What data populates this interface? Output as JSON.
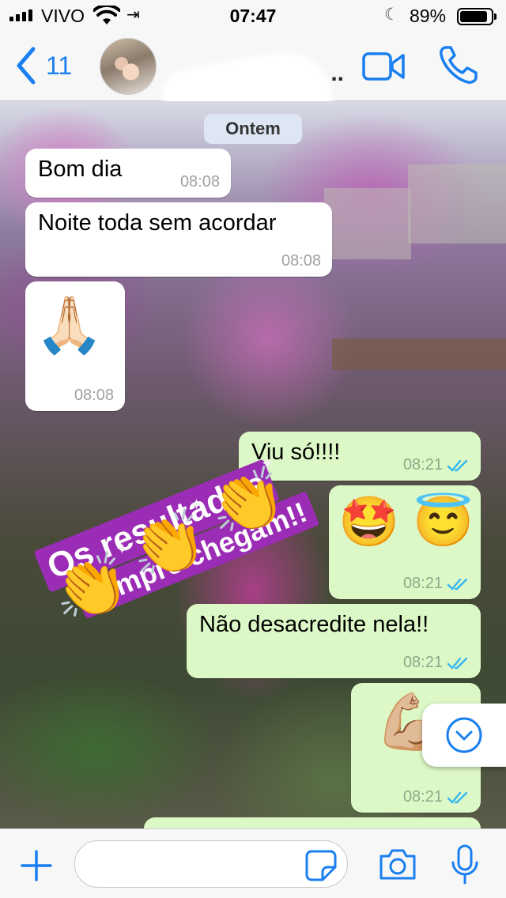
{
  "status_bar": {
    "carrier": "VIVO",
    "time": "07:47",
    "battery_percent": "89%",
    "battery_level": 0.89,
    "icons": [
      "signal-icon",
      "wifi-icon",
      "login-arrow-icon",
      "do-not-disturb-moon-icon",
      "battery-icon"
    ]
  },
  "nav": {
    "back_count": "11",
    "contact_name": "..",
    "icons": [
      "back-chevron-icon",
      "video-call-icon",
      "phone-call-icon"
    ]
  },
  "chat": {
    "date_separator": "Ontem",
    "messages": [
      {
        "direction": "in",
        "text": "Bom dia",
        "time": "08:08"
      },
      {
        "direction": "in",
        "text": "Noite toda sem acordar",
        "time": "08:08"
      },
      {
        "direction": "in",
        "emoji": "🙏🏻",
        "time": "08:08"
      },
      {
        "direction": "out",
        "text": "Viu só!!!!",
        "time": "08:21",
        "status": "read"
      },
      {
        "direction": "out",
        "emoji": "🤩 😇",
        "time": "08:21",
        "status": "read"
      },
      {
        "direction": "out",
        "text": "Não desacredite nela!!",
        "time": "08:21",
        "status": "read"
      },
      {
        "direction": "out",
        "emoji": "💪🏼",
        "time": "08:21",
        "status": "read"
      }
    ],
    "sticker": {
      "line1": "Os resultados",
      "line2": "sempre chegam!!",
      "clap_emoji": "👏"
    },
    "accent_colors": {
      "incoming_bubble": "#ffffff",
      "outgoing_bubble": "#dcf8c6",
      "read_ticks": "#34b7f1",
      "sticker_bg": "#9b2cb6"
    }
  },
  "input_bar": {
    "placeholder": "",
    "icons": [
      "plus-icon",
      "sticker-icon",
      "camera-icon",
      "microphone-icon"
    ]
  }
}
